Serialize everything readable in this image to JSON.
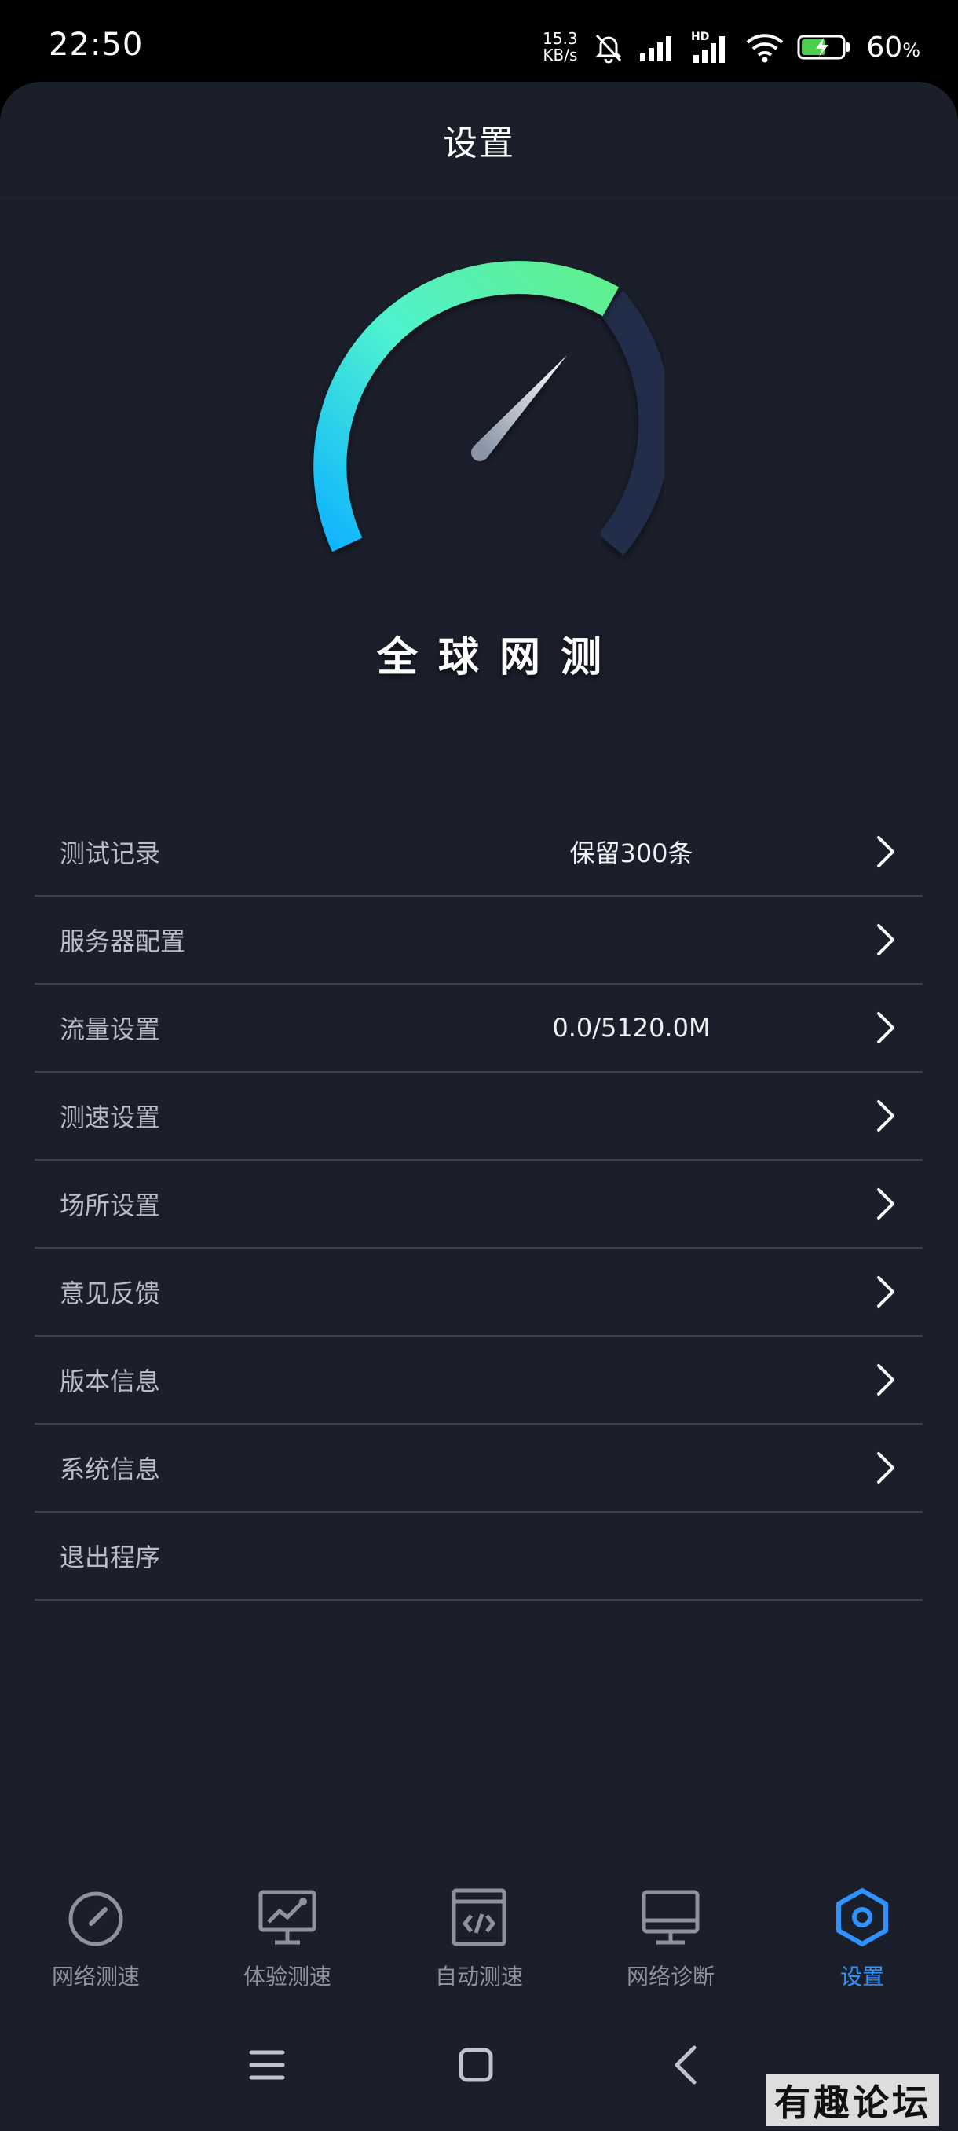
{
  "status_bar": {
    "time": "22:50",
    "net_speed_value": "15.3",
    "net_speed_unit": "KB/s",
    "battery": "60",
    "battery_unit": "%",
    "signal_label": "HD",
    "icons": [
      "mute-bell-icon",
      "signal-icon",
      "hd-signal-icon",
      "wifi-icon",
      "battery-charging-icon"
    ]
  },
  "header": {
    "title": "设置"
  },
  "brand": {
    "name": "全球网测"
  },
  "gauge": {
    "needle_angle_deg": 40,
    "accent_colors": [
      "#10b4ff",
      "#4ef2d0",
      "#61ef8c",
      "#242d4a"
    ]
  },
  "settings": {
    "items": [
      {
        "label": "测试记录",
        "value": "保留300条"
      },
      {
        "label": "服务器配置",
        "value": ""
      },
      {
        "label": "流量设置",
        "value": "0.0/5120.0M"
      },
      {
        "label": "测速设置",
        "value": ""
      },
      {
        "label": "场所设置",
        "value": ""
      },
      {
        "label": "意见反馈",
        "value": ""
      },
      {
        "label": "版本信息",
        "value": ""
      },
      {
        "label": "系统信息",
        "value": ""
      },
      {
        "label": "退出程序",
        "value": ""
      }
    ]
  },
  "tabs": [
    {
      "label": "网络测速",
      "icon": "speedometer-icon",
      "active": false
    },
    {
      "label": "体验测速",
      "icon": "monitor-chart-icon",
      "active": false
    },
    {
      "label": "自动测速",
      "icon": "code-window-icon",
      "active": false
    },
    {
      "label": "网络诊断",
      "icon": "desktop-icon",
      "active": false
    },
    {
      "label": "设置",
      "icon": "hexagon-settings-icon",
      "active": true
    }
  ],
  "colors": {
    "background": "#1b1f2b",
    "active_tab": "#2f93ff",
    "divider": "#3a4050"
  },
  "watermark": "有趣论坛"
}
